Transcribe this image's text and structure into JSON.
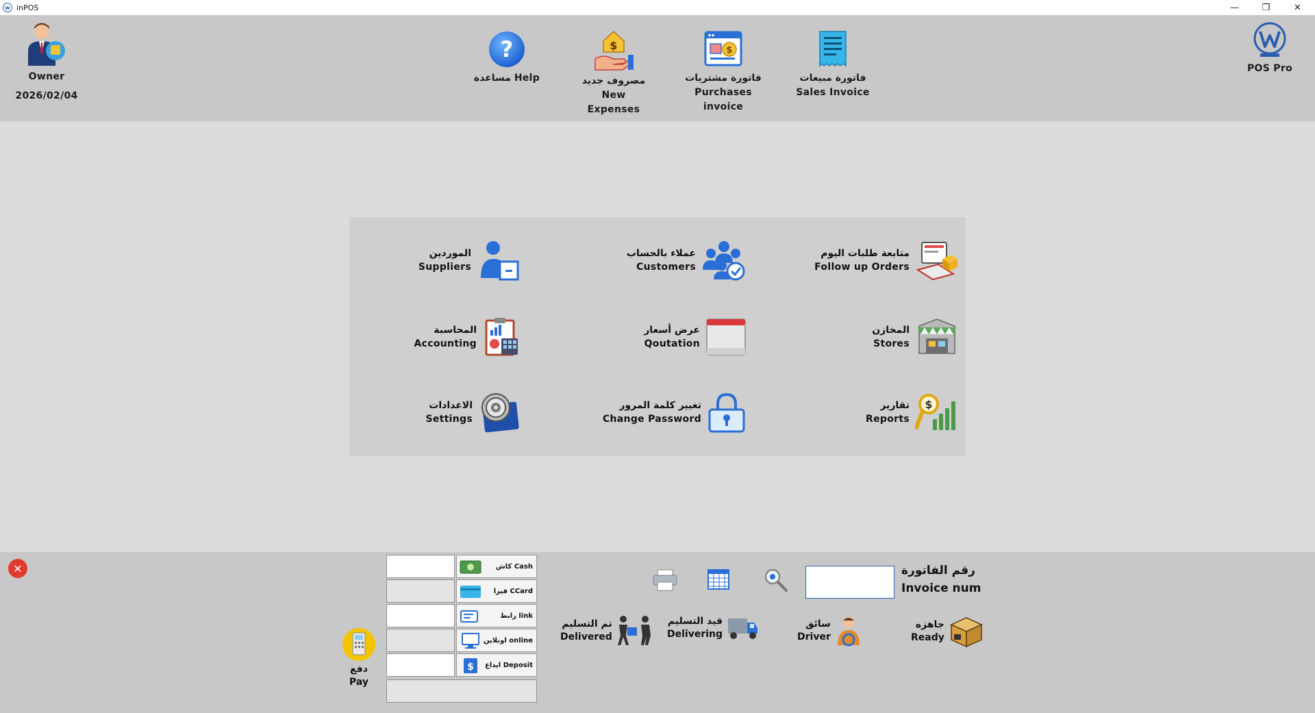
{
  "window": {
    "title": "inPOS",
    "minimize_glyph": "—",
    "restore_glyph": "❐",
    "close_glyph": "✕"
  },
  "user": {
    "role": "Owner",
    "date": "2026/02/04"
  },
  "brand": {
    "name": "POS Pro"
  },
  "toolbar": {
    "help": {
      "label": "مساعدة Help",
      "icon": "help-icon"
    },
    "expenses": {
      "label_line1": "مصروف جديد New",
      "label_line2": "Expenses",
      "icon": "expenses-icon"
    },
    "purchases": {
      "label_line1": "فاتورة مشتريات",
      "label_line2": "Purchases invoice",
      "icon": "purchases-invoice-icon"
    },
    "sales": {
      "label_line1": "فاتورة  مبيعات",
      "label_line2": "Sales Invoice",
      "icon": "sales-invoice-icon"
    }
  },
  "menu": {
    "follow_up_orders": {
      "ar": "متابعة طلبات اليوم",
      "en": "Follow up Orders"
    },
    "customers": {
      "ar": "عملاء بالحساب",
      "en": "Customers"
    },
    "suppliers": {
      "ar": "الموردين",
      "en": "Suppliers"
    },
    "stores": {
      "ar": "المخازن",
      "en": "Stores"
    },
    "quotation": {
      "ar": "عرض أسعار",
      "en": "Qoutation"
    },
    "accounting": {
      "ar": "المحاسبة",
      "en": "Accounting"
    },
    "reports": {
      "ar": "تقارير",
      "en": "Reports"
    },
    "change_password": {
      "ar": "تغيير كلمة المرور",
      "en": "Change Password"
    },
    "settings": {
      "ar": "الاعدادات",
      "en": "Settings"
    }
  },
  "payment": {
    "close_glyph": "✕",
    "methods": [
      {
        "label": "كاش Cash",
        "value": ""
      },
      {
        "label": "فيزا CCard",
        "value": ""
      },
      {
        "label": "رابط link",
        "value": ""
      },
      {
        "label": "اونلاين online",
        "value": ""
      },
      {
        "label": "ايداع Deposit",
        "value": ""
      }
    ],
    "pay": {
      "ar": "دفع",
      "en": "Pay"
    }
  },
  "status": {
    "delivered": {
      "ar": "تم التسليم",
      "en": "Delivered"
    },
    "delivering": {
      "ar": "قيد التسليم",
      "en": "Delivering"
    },
    "driver": {
      "ar": "سائق",
      "en": "Driver"
    },
    "ready": {
      "ar": "جاهزه",
      "en": "Ready"
    }
  },
  "invoice": {
    "label_ar": "رقم الفاتورة",
    "label_en": "Invoice num",
    "value": ""
  },
  "colors": {
    "accent_blue": "#2a6fd6",
    "close_red": "#e03a2f",
    "pay_yellow": "#f5c400"
  }
}
